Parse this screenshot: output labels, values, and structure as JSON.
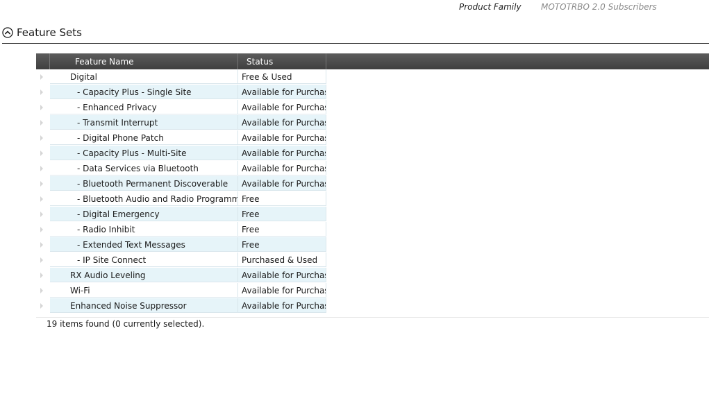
{
  "product_family": {
    "label": "Product Family",
    "value": "MOTOTRBO 2.0 Subscribers"
  },
  "section": {
    "title": "Feature Sets",
    "toggle_icon": "chevron-up-circle-icon"
  },
  "grid": {
    "columns": [
      "Feature Name",
      "Status"
    ],
    "rows": [
      {
        "name": "Digital",
        "status": "Free & Used",
        "level": "top"
      },
      {
        "name": "- Capacity Plus - Single Site",
        "status": "Available for Purchase",
        "level": "sub"
      },
      {
        "name": "- Enhanced Privacy",
        "status": "Available for Purchase",
        "level": "sub"
      },
      {
        "name": "- Transmit Interrupt",
        "status": "Available for Purchase",
        "level": "sub"
      },
      {
        "name": "- Digital Phone Patch",
        "status": "Available for Purchase",
        "level": "sub"
      },
      {
        "name": "- Capacity Plus - Multi-Site",
        "status": "Available for Purchase",
        "level": "sub"
      },
      {
        "name": "- Data Services via Bluetooth",
        "status": "Available for Purchase",
        "level": "sub"
      },
      {
        "name": "- Bluetooth Permanent Discoverable",
        "status": "Available for Purchase",
        "level": "sub"
      },
      {
        "name": "- Bluetooth Audio and Radio Programming",
        "status": "Free",
        "level": "sub"
      },
      {
        "name": "- Digital Emergency",
        "status": "Free",
        "level": "sub"
      },
      {
        "name": "- Radio Inhibit",
        "status": "Free",
        "level": "sub"
      },
      {
        "name": "- Extended Text Messages",
        "status": "Free",
        "level": "sub"
      },
      {
        "name": "- IP Site Connect",
        "status": "Purchased & Used",
        "level": "sub"
      },
      {
        "name": "RX Audio Leveling",
        "status": "Available for Purchase",
        "level": "top"
      },
      {
        "name": "Wi-Fi",
        "status": "Available for Purchase",
        "level": "top"
      },
      {
        "name": "Enhanced Noise Suppressor",
        "status": "Available for Purchase",
        "level": "top"
      }
    ]
  },
  "status_text": "19 items found (0 currently selected)."
}
